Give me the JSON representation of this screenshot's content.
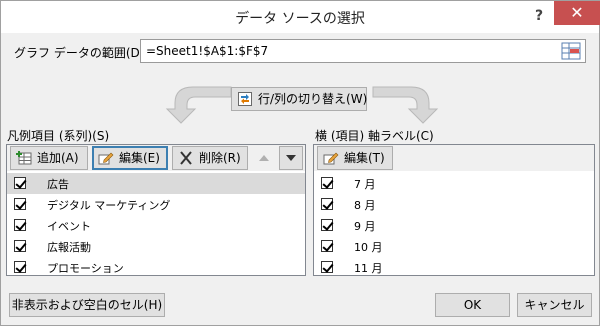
{
  "dialog": {
    "title": "データ ソースの選択",
    "help": "?",
    "close": "✕"
  },
  "range": {
    "label": "グラフ データの範囲(D):",
    "value": "=Sheet1!$A$1:$F$7"
  },
  "switch_button": "行/列の切り替え(W)",
  "legend": {
    "label": "凡例項目 (系列)(S)",
    "add": "追加(A)",
    "edit": "編集(E)",
    "delete": "削除(R)",
    "items": [
      "広告",
      "デジタル マーケティング",
      "イベント",
      "広報活動",
      "プロモーション"
    ]
  },
  "axis": {
    "label": "横 (項目) 軸ラベル(C)",
    "edit": "編集(T)",
    "items": [
      "7 月",
      "8 月",
      "9 月",
      "10 月",
      "11 月"
    ]
  },
  "buttons": {
    "hidden": "非表示および空白のセル(H)",
    "ok": "OK",
    "cancel": "キャンセル"
  },
  "colors": {
    "close_bg": "#c75050",
    "focus": "#3c7fb1",
    "selected_row": "#dadada"
  },
  "icons": {
    "range_picker": "range-select-icon",
    "switch": "swap-rows-columns-icon",
    "add": "add-table-icon",
    "edit": "pencil-icon",
    "delete": "x-icon",
    "up": "triangle-up-icon",
    "down": "triangle-down-icon"
  }
}
